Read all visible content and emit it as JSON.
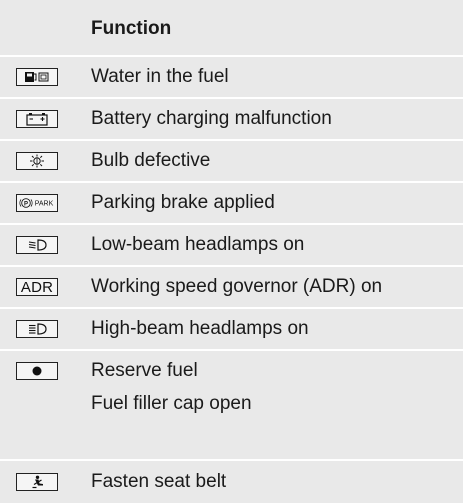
{
  "table": {
    "header": "Function",
    "rows": [
      {
        "icon": "water-in-fuel-icon",
        "lines": [
          "Water in the fuel"
        ]
      },
      {
        "icon": "battery-icon",
        "lines": [
          "Battery charging malfunction"
        ]
      },
      {
        "icon": "bulb-defective-icon",
        "lines": [
          "Bulb defective"
        ]
      },
      {
        "icon": "parking-brake-icon",
        "icon_text": "PARK",
        "lines": [
          "Parking brake applied"
        ]
      },
      {
        "icon": "low-beam-icon",
        "lines": [
          "Low-beam headlamps on"
        ]
      },
      {
        "icon": "adr-icon",
        "icon_text": "ADR",
        "lines": [
          "Working speed governor (ADR) on"
        ]
      },
      {
        "icon": "high-beam-icon",
        "lines": [
          "High-beam headlamps on"
        ]
      },
      {
        "icon": "reserve-fuel-dot-icon",
        "lines": [
          "Reserve fuel",
          "Fuel filler cap open"
        ]
      },
      {
        "icon": "seat-belt-icon",
        "lines": [
          "Fasten seat belt"
        ]
      }
    ]
  }
}
